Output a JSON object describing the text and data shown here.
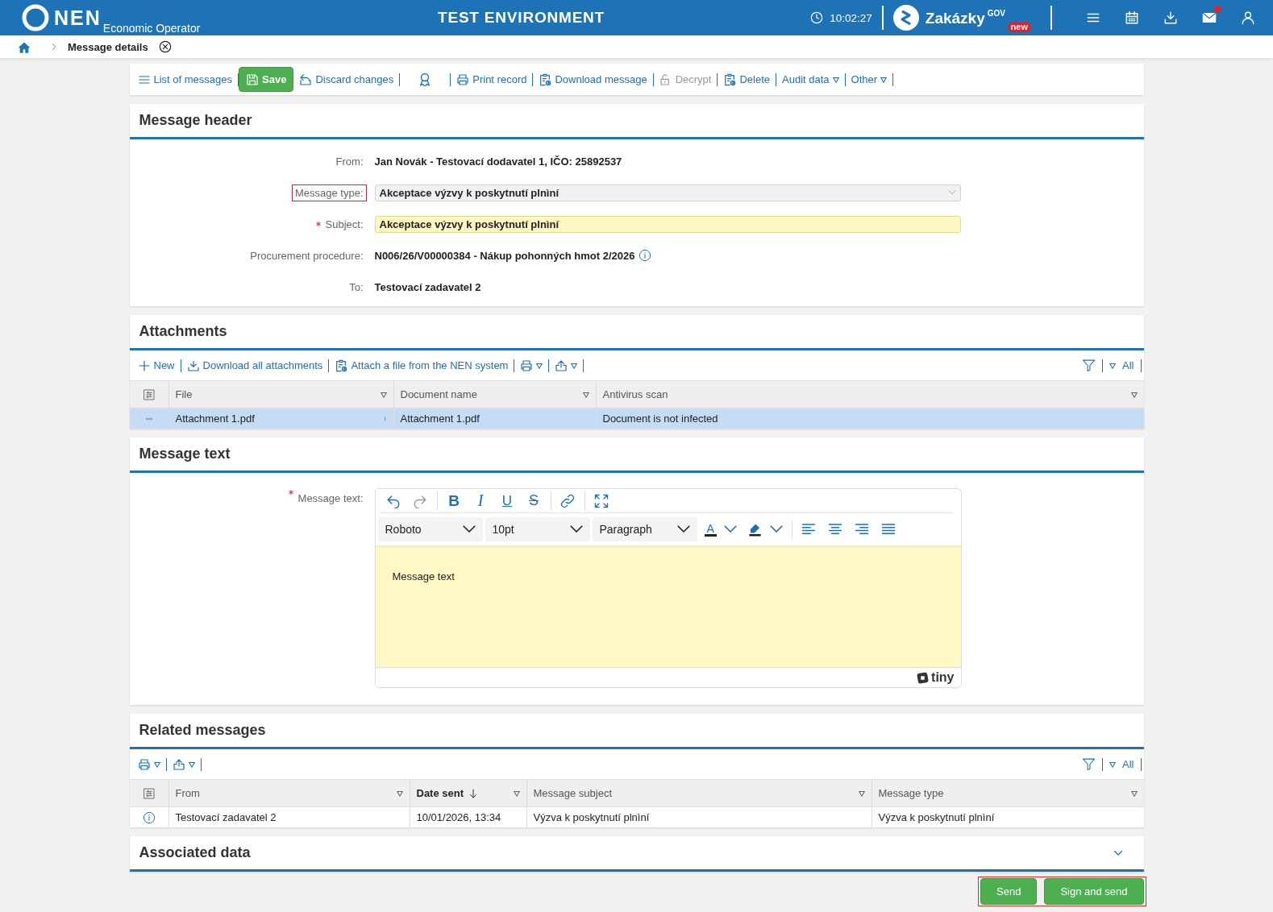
{
  "top_bar": {
    "logo_text": "NEN",
    "subtitle": "Economic Operator",
    "environment": "TEST ENVIRONMENT",
    "time": "10:02:27",
    "brand": "Zakázky$^{GOV}$",
    "brand_badge": "new",
    "mail_unread": true
  },
  "breadcrumb": {
    "current": "Message details"
  },
  "toolbar": [
    {
      "kind": "list",
      "label": "List of messages",
      "disabled": false
    },
    {
      "kind": "save",
      "label": "Save",
      "disabled": false
    },
    {
      "kind": "discard",
      "label": "Discard changes",
      "disabled": false
    },
    {
      "kind": "award",
      "disabled": false
    },
    {
      "kind": "print",
      "label": "Print record",
      "disabled": false
    },
    {
      "kind": "download",
      "label": "Download message",
      "disabled": false
    },
    {
      "kind": "decrypt",
      "label": "Decrypt",
      "disabled": true
    },
    {
      "kind": "delete",
      "label": "Delete",
      "disabled": false
    },
    {
      "kind": "menu",
      "label": "Audit data",
      "disabled": false
    },
    {
      "kind": "menu",
      "label": "Other",
      "disabled": false
    }
  ],
  "header_section": {
    "title": "Message header",
    "fields": [
      {
        "kind": "text",
        "label": "From:",
        "value": "Jan Novák - Testovací dodavatel 1, IČO: 25892537",
        "required": false,
        "highlighted": false,
        "info": false
      },
      {
        "kind": "select",
        "label": "Message type:",
        "value": "Akceptace výzvy k poskytnutí plnìní",
        "required": false,
        "highlighted": true,
        "info": false
      },
      {
        "kind": "input",
        "label": "Subject:",
        "value": "Akceptace výzvy k poskytnutí plnìní",
        "required": true,
        "highlighted": false,
        "info": false
      },
      {
        "kind": "text",
        "label": "Procurement procedure:",
        "value": "N006/26/V00000384 - Nákup pohonných hmot 2/2026",
        "required": false,
        "highlighted": false,
        "info": true
      },
      {
        "kind": "text",
        "label": "To:",
        "value": "Testovací zadavatel 2",
        "required": false,
        "highlighted": false,
        "info": false
      }
    ]
  },
  "attachments": {
    "title": "Attachments",
    "actions": [
      {
        "kind": "new",
        "label": "New"
      },
      {
        "kind": "download",
        "label": "Download all attachments"
      },
      {
        "kind": "attach",
        "label": "Attach a file from the NEN system"
      },
      {
        "kind": "print"
      },
      {
        "kind": "export"
      }
    ],
    "filter_label": "All",
    "columns": [
      {
        "label": "File",
        "sorted": false
      },
      {
        "label": "Document name",
        "sorted": false
      },
      {
        "label": "Antivirus scan",
        "sorted": false
      }
    ],
    "rows": [
      {
        "selected": true,
        "cells": [
          "Attachment 1.pdf",
          "Attachment 1.pdf",
          "Document is not infected"
        ]
      }
    ]
  },
  "message_text": {
    "title": "Message text",
    "label": "Message text:",
    "required": true,
    "editor": {
      "toolbar": [
        {
          "groups": [
            {
              "items": [
                {
                  "kind": "undo",
                  "disabled": false
                },
                {
                  "kind": "redo",
                  "disabled": true
                }
              ]
            },
            {
              "items": [
                {
                  "kind": "bold",
                  "label": "B",
                  "disabled": false
                },
                {
                  "kind": "italic",
                  "label": "I",
                  "disabled": false
                },
                {
                  "kind": "underline",
                  "label": "U",
                  "disabled": false
                },
                {
                  "kind": "strike",
                  "label": "S",
                  "disabled": false
                }
              ]
            },
            {
              "items": [
                {
                  "kind": "link",
                  "disabled": false
                }
              ]
            },
            {
              "items": [
                {
                  "kind": "fullscreen",
                  "disabled": false
                }
              ]
            }
          ]
        },
        {
          "groups": [
            {
              "items": [
                {
                  "kind": "select",
                  "value": "Roboto",
                  "disabled": false
                },
                {
                  "kind": "select",
                  "value": "10pt",
                  "disabled": false
                },
                {
                  "kind": "select",
                  "value": "Paragraph",
                  "disabled": false
                },
                {
                  "kind": "textcolor",
                  "label": "A",
                  "disabled": false
                },
                {
                  "kind": "highlight",
                  "disabled": false
                }
              ]
            },
            {
              "items": [
                {
                  "kind": "alignleft",
                  "disabled": false
                },
                {
                  "kind": "aligncenter",
                  "disabled": false
                },
                {
                  "kind": "alignright",
                  "disabled": false
                },
                {
                  "kind": "justify",
                  "disabled": false
                }
              ]
            }
          ]
        }
      ],
      "content": "Message text",
      "brand": "tiny"
    }
  },
  "related_messages": {
    "title": "Related messages",
    "actions": [
      {
        "kind": "print"
      },
      {
        "kind": "export"
      }
    ],
    "filter_label": "All",
    "columns": [
      {
        "label": "From",
        "sorted": false
      },
      {
        "label": "Date sent",
        "sorted": true
      },
      {
        "label": "Message subject",
        "sorted": false
      },
      {
        "label": "Message type",
        "sorted": false
      }
    ],
    "rows": [
      {
        "selected": false,
        "cells": [
          "Testovací zadavatel 2",
          "10/01/2026, 13:34",
          "Výzva k poskytnutí plnìní",
          "Výzva k poskytnutí plnìní"
        ]
      }
    ]
  },
  "associated_data": {
    "title": "Associated data",
    "expanded": false
  },
  "footer": {
    "highlighted": true,
    "buttons": [
      {
        "label": "Send"
      },
      {
        "label": "Sign and send"
      }
    ]
  }
}
